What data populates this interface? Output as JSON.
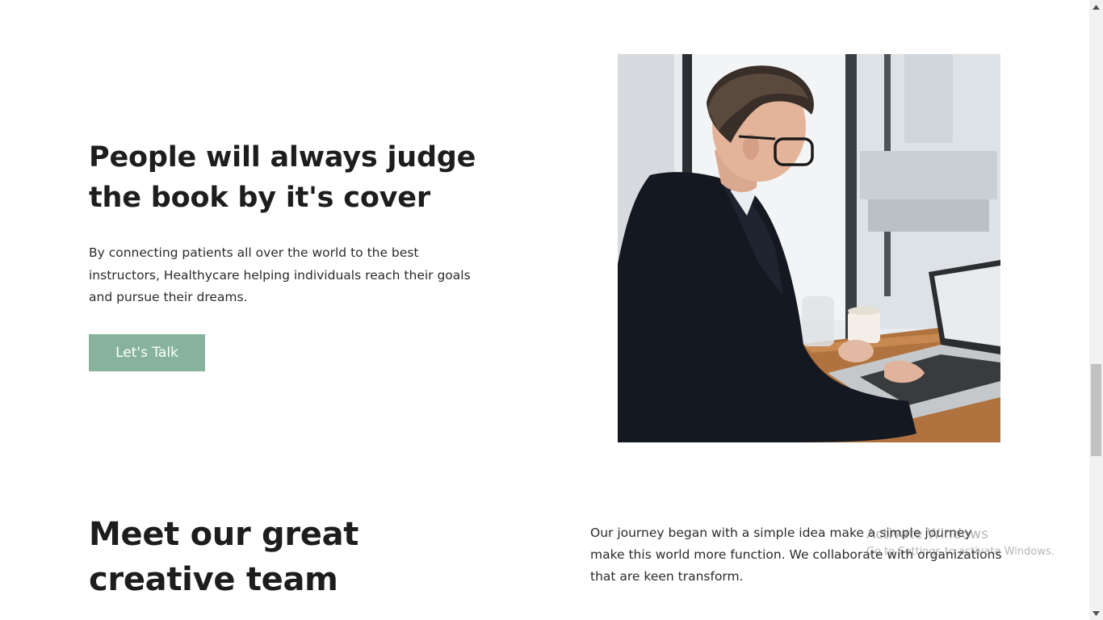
{
  "hero": {
    "title_line1": "People will always judge",
    "title_line2": "the book by it's cover",
    "description": "By connecting patients all over the world to the best instructors, Healthycare helping individuals reach their goals and pursue their dreams.",
    "cta_label": "Let's Talk",
    "cta_color": "#87b39d"
  },
  "team": {
    "title_line1": "Meet our great",
    "title_line2": "creative team",
    "description": "Our journey began with a simple idea make a simple journey make this world more function. We collaborate with organizations that are keen transform."
  },
  "watermark": {
    "title": "Activate Windows",
    "subtitle": "Go to Settings to activate Windows."
  },
  "icons": {
    "scroll_up": "chevron-up-icon",
    "scroll_down": "chevron-down-icon"
  }
}
